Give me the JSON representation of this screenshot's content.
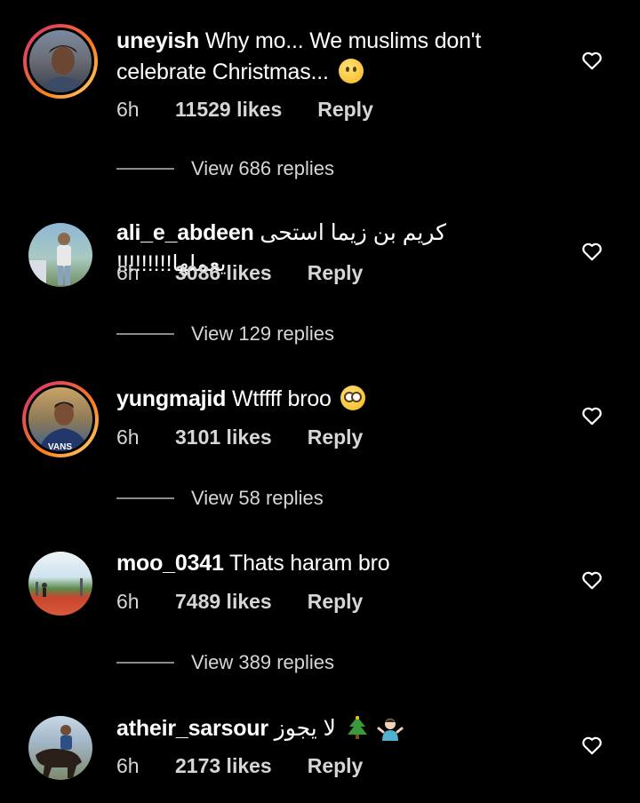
{
  "comments": [
    {
      "username": "uneyish",
      "text": "Why mo... We muslims don't celebrate Christmas...",
      "emoji": "sad-face-emoji",
      "time": "6h",
      "likes": "11529 likes",
      "reply_label": "Reply",
      "view_replies": "View 686 replies",
      "story_ring": true
    },
    {
      "username": "ali_e_abdeen",
      "text": "كريم بن زيما استحى يعملها!!!!!!!!!",
      "time": "6h",
      "likes": "3086 likes",
      "reply_label": "Reply",
      "view_replies": "View 129 replies",
      "story_ring": false
    },
    {
      "username": "yungmajid",
      "text": "Wtffff broo",
      "emoji": "flushed-face-emoji",
      "time": "6h",
      "likes": "3101 likes",
      "reply_label": "Reply",
      "view_replies": "View 58 replies",
      "story_ring": true
    },
    {
      "username": "moo_0341",
      "text": "Thats haram bro",
      "time": "6h",
      "likes": "7489 likes",
      "reply_label": "Reply",
      "view_replies": "View 389 replies",
      "story_ring": false
    },
    {
      "username": "atheir_sarsour",
      "text": "لا يجوز",
      "emoji": "christmas-tree-emoji shrugging-man-emoji",
      "time": "6h",
      "likes": "2173 likes",
      "reply_label": "Reply",
      "story_ring": false
    }
  ],
  "colors": {
    "background": "#000000",
    "text": "#ffffff",
    "secondary_text": "#d6d6d6",
    "story_ring_start": "#d62976",
    "story_ring_end": "#feda75"
  },
  "icons": {
    "like": "heart-outline-icon"
  }
}
